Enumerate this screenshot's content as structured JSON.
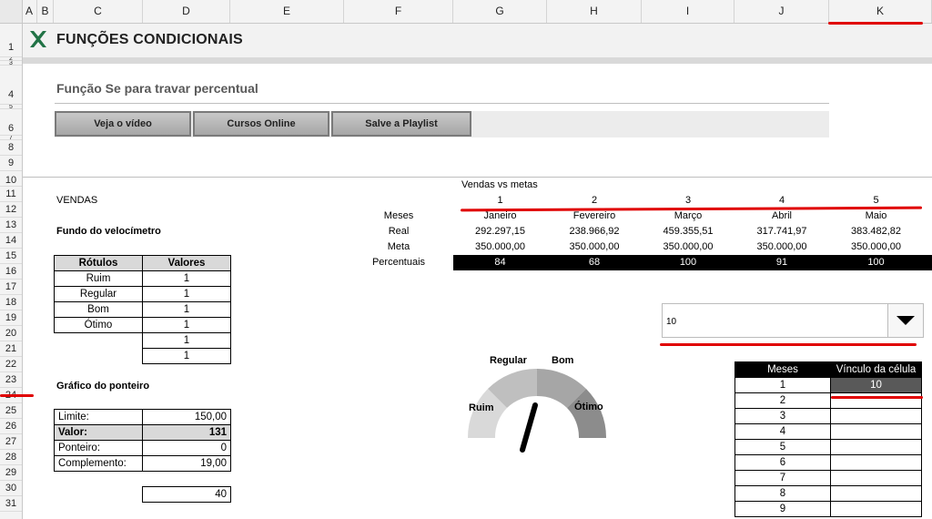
{
  "columns": [
    "A",
    "B",
    "C",
    "D",
    "E",
    "F",
    "G",
    "H",
    "I",
    "J",
    "K"
  ],
  "rows": [
    "1",
    "2",
    "3",
    "4",
    "5",
    "6",
    "7",
    "8",
    "9",
    "10",
    "11",
    "12",
    "13",
    "14",
    "15",
    "16",
    "17",
    "18",
    "19",
    "20",
    "21",
    "22",
    "23",
    "24",
    "25",
    "26",
    "27",
    "28",
    "29",
    "30",
    "31"
  ],
  "header": {
    "title": "FUNÇÕES CONDICIONAIS",
    "logo_icon": "excel-x-icon",
    "accent": "#217346"
  },
  "subtitle": "Função Se para travar percentual",
  "buttons": [
    "Veja o vídeo",
    "Cursos Online",
    "Salve a Playlist"
  ],
  "left": {
    "vendas_label": "VENDAS",
    "fundo_title": "Fundo do velocímetro",
    "rotulos_headers": [
      "Rótulos",
      "Valores"
    ],
    "rotulos_rows": [
      [
        "Ruim",
        "1"
      ],
      [
        "Regular",
        "1"
      ],
      [
        "Bom",
        "1"
      ],
      [
        "Ótimo",
        "1"
      ],
      [
        "",
        "1"
      ],
      [
        "",
        "1"
      ]
    ],
    "ponteiro_title": "Gráfico do ponteiro",
    "ponteiro_rows": [
      [
        "Limite:",
        "150,00"
      ],
      [
        "Valor:",
        "131"
      ],
      [
        "Ponteiro:",
        "0"
      ],
      [
        "Complemento:",
        "19,00"
      ]
    ],
    "extra_value": "40"
  },
  "vendas": {
    "title": "Vendas vs metas",
    "numbers": [
      "1",
      "2",
      "3",
      "4",
      "5"
    ],
    "row_labels": [
      "Meses",
      "Real",
      "Meta",
      "Percentuais"
    ],
    "meses": [
      "Janeiro",
      "Fevereiro",
      "Março",
      "Abril",
      "Maio"
    ],
    "real": [
      "292.297,15",
      "238.966,92",
      "459.355,51",
      "317.741,97",
      "383.482,82"
    ],
    "meta": [
      "350.000,00",
      "350.000,00",
      "350.000,00",
      "350.000,00",
      "350.000,00"
    ],
    "percentuais": [
      "84",
      "68",
      "100",
      "91",
      "100"
    ]
  },
  "dropdown": {
    "value": "10",
    "arrow_icon": "triangle-down-icon"
  },
  "gauge": {
    "labels": [
      "Ruim",
      "Regular",
      "Bom",
      "Ótimo"
    ],
    "needle_value": 131,
    "limit": 150
  },
  "meses_table": {
    "headers": [
      "Meses",
      "Vínculo da célula"
    ],
    "months": [
      "1",
      "2",
      "3",
      "4",
      "5",
      "6",
      "7",
      "8",
      "9"
    ],
    "link_value": "10"
  }
}
